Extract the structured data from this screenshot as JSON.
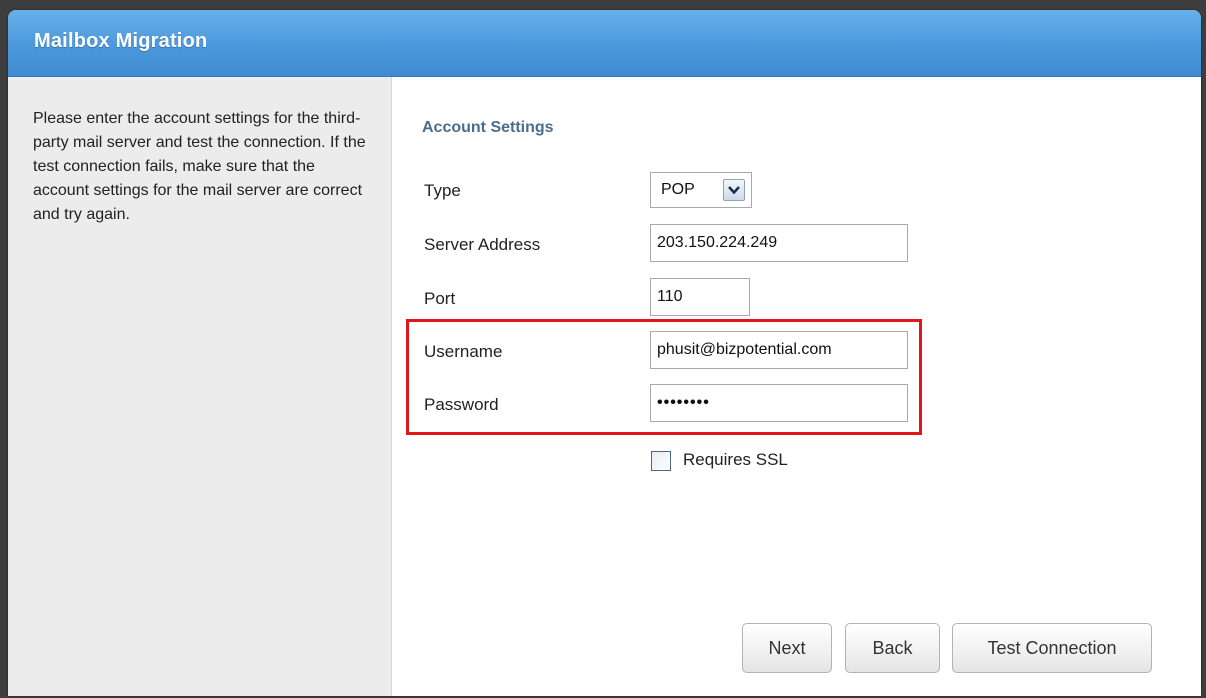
{
  "window": {
    "title": "Mailbox Migration"
  },
  "sidebar": {
    "instructions": "Please enter the account settings for the third-party mail server and test the connection. If the test connection fails, make sure that the account settings for the mail server are correct and try again."
  },
  "account_settings": {
    "section_title": "Account Settings",
    "type": {
      "label": "Type",
      "value": "POP"
    },
    "server_address": {
      "label": "Server Address",
      "value": "203.150.224.249"
    },
    "port": {
      "label": "Port",
      "value": "110"
    },
    "username": {
      "label": "Username",
      "value": "phusit@bizpotential.com"
    },
    "password": {
      "label": "Password",
      "value": "••••••••"
    },
    "requires_ssl": {
      "label": "Requires SSL",
      "checked": false
    }
  },
  "buttons": {
    "next": "Next",
    "back": "Back",
    "test_connection": "Test Connection"
  },
  "colors": {
    "titlebar": "#4b98dc",
    "section_title": "#4a6d8e",
    "highlight": "#e0161b",
    "sidebar_bg": "#ececec"
  }
}
